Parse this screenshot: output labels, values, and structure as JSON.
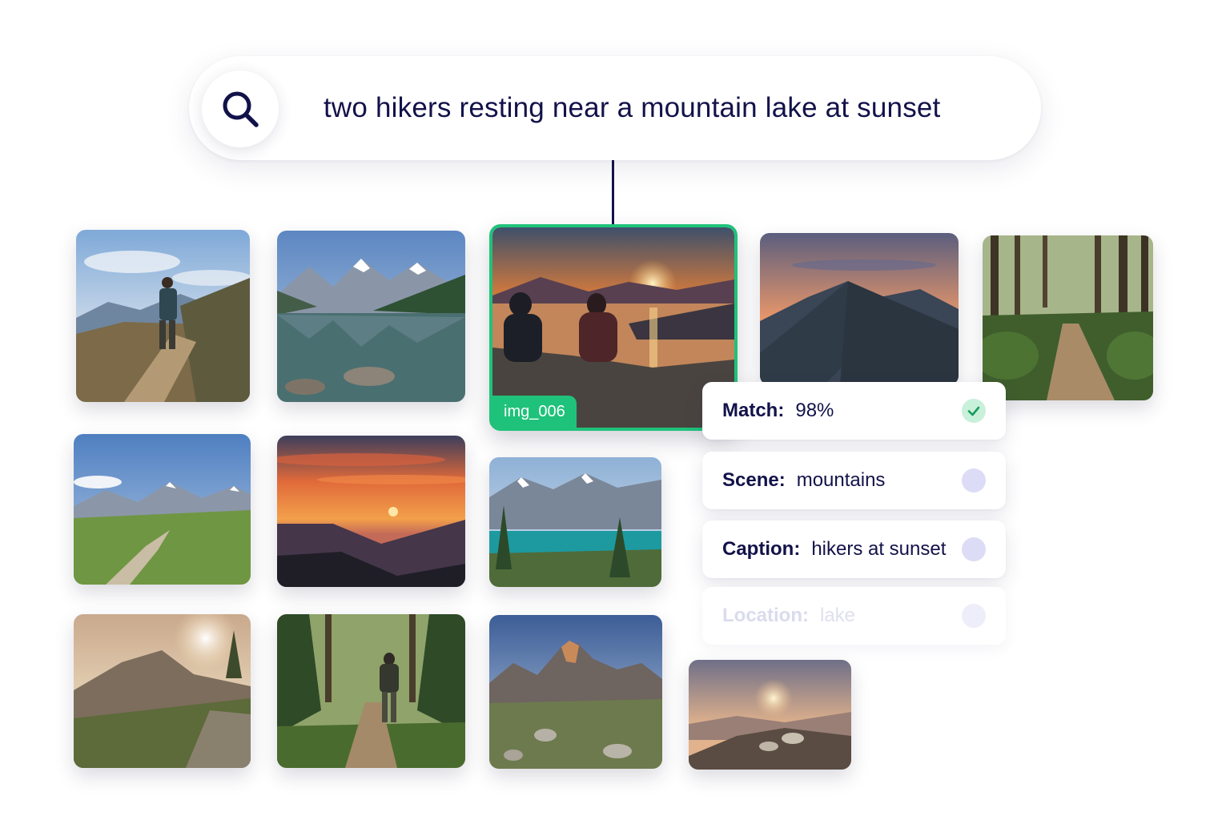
{
  "search": {
    "query": "two hikers resting near a mountain lake at sunset",
    "icon": "search-icon"
  },
  "results": {
    "selected": {
      "tag": "img_006",
      "highlight_color": "#1fc27a"
    },
    "thumbnails": [
      {
        "scene": "hiker walking on mountain trail"
      },
      {
        "scene": "mountain lake reflection"
      },
      {
        "scene": "two hikers at lakeside sunset"
      },
      {
        "scene": "mountain ridge at dusk"
      },
      {
        "scene": "forest trail"
      },
      {
        "scene": "alpine meadow trail"
      },
      {
        "scene": "sunset over mountains"
      },
      {
        "scene": "turquoise alpine lake"
      },
      {
        "scene": "mountain sunrise with wildflowers"
      },
      {
        "scene": "hiker in forest"
      },
      {
        "scene": "rocky mountain valley"
      },
      {
        "scene": "hazy sunset over hills"
      }
    ]
  },
  "metadata": {
    "match": {
      "key": "Match:",
      "value": "98%",
      "status": "check"
    },
    "scene": {
      "key": "Scene:",
      "value": "mountains"
    },
    "caption": {
      "key": "Caption:",
      "value": "hikers at sunset"
    },
    "location": {
      "key": "Location:",
      "value": "lake"
    }
  },
  "colors": {
    "text": "#12124a",
    "accent": "#1fc27a",
    "dot": "#dcdcf7"
  }
}
